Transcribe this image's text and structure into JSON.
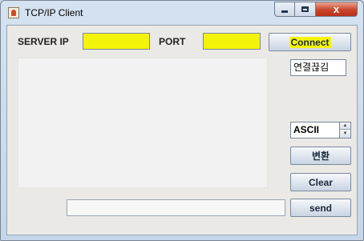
{
  "window": {
    "title": "TCP/IP Client",
    "close_label": "x"
  },
  "connection": {
    "server_ip_label": "SERVER IP",
    "server_ip_value": "",
    "port_label": "PORT",
    "port_value": "",
    "connect_label": "Connect"
  },
  "status": {
    "disconnect_label": "연결끊김"
  },
  "encoding": {
    "selected": "ASCII",
    "convert_label": "변환",
    "clear_label": "Clear"
  },
  "send": {
    "input_value": "",
    "send_label": "send"
  },
  "colors": {
    "highlight": "#f4f40a",
    "panel": "#ebe9e6",
    "close_button": "#c8452b"
  }
}
